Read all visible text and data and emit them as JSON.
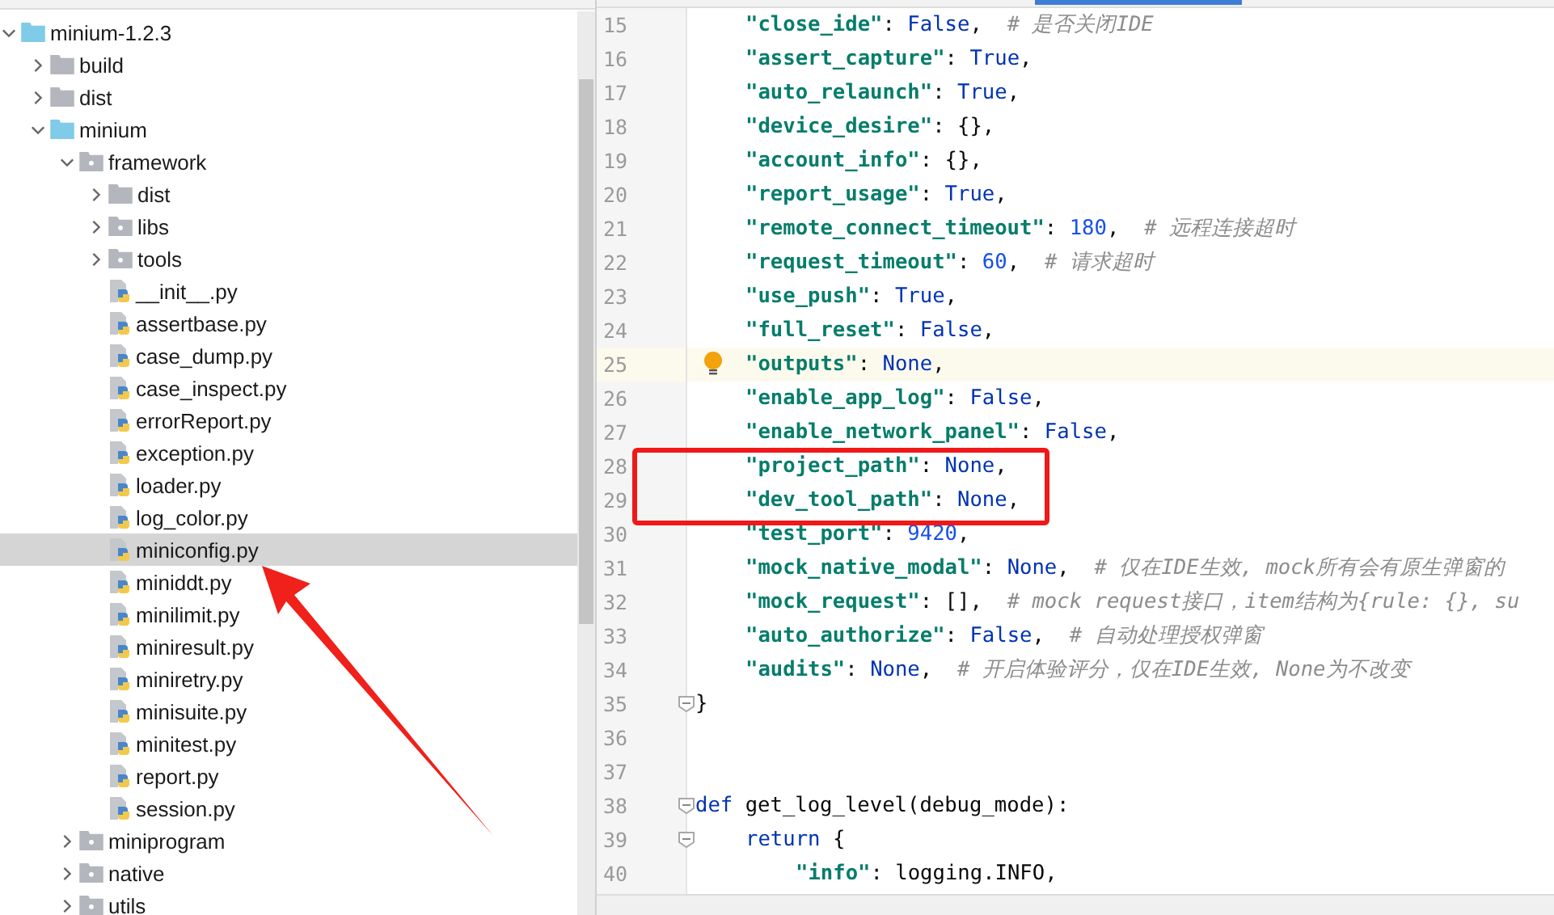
{
  "project_tree": [
    {
      "name": "minium-1.2.3",
      "kind": "root",
      "expanded": true,
      "selected": false,
      "children": [
        {
          "name": "build",
          "kind": "folder",
          "expanded": false,
          "selected": false
        },
        {
          "name": "dist",
          "kind": "folder",
          "expanded": false,
          "selected": false
        },
        {
          "name": "minium",
          "kind": "root",
          "expanded": true,
          "selected": false,
          "children": [
            {
              "name": "framework",
              "kind": "package",
              "expanded": true,
              "selected": false,
              "children": [
                {
                  "name": "dist",
                  "kind": "folder",
                  "expanded": false,
                  "selected": false
                },
                {
                  "name": "libs",
                  "kind": "package",
                  "expanded": false,
                  "selected": false
                },
                {
                  "name": "tools",
                  "kind": "package",
                  "expanded": false,
                  "selected": false
                },
                {
                  "name": "__init__.py",
                  "kind": "python",
                  "selected": false
                },
                {
                  "name": "assertbase.py",
                  "kind": "python",
                  "selected": false
                },
                {
                  "name": "case_dump.py",
                  "kind": "python",
                  "selected": false
                },
                {
                  "name": "case_inspect.py",
                  "kind": "python",
                  "selected": false
                },
                {
                  "name": "errorReport.py",
                  "kind": "python",
                  "selected": false
                },
                {
                  "name": "exception.py",
                  "kind": "python",
                  "selected": false
                },
                {
                  "name": "loader.py",
                  "kind": "python",
                  "selected": false
                },
                {
                  "name": "log_color.py",
                  "kind": "python",
                  "selected": false
                },
                {
                  "name": "miniconfig.py",
                  "kind": "python",
                  "selected": true
                },
                {
                  "name": "miniddt.py",
                  "kind": "python",
                  "selected": false
                },
                {
                  "name": "minilimit.py",
                  "kind": "python",
                  "selected": false
                },
                {
                  "name": "miniresult.py",
                  "kind": "python",
                  "selected": false
                },
                {
                  "name": "miniretry.py",
                  "kind": "python",
                  "selected": false
                },
                {
                  "name": "minisuite.py",
                  "kind": "python",
                  "selected": false
                },
                {
                  "name": "minitest.py",
                  "kind": "python",
                  "selected": false
                },
                {
                  "name": "report.py",
                  "kind": "python",
                  "selected": false
                },
                {
                  "name": "session.py",
                  "kind": "python",
                  "selected": false
                }
              ]
            },
            {
              "name": "miniprogram",
              "kind": "package",
              "expanded": false,
              "selected": false
            },
            {
              "name": "native",
              "kind": "package",
              "expanded": false,
              "selected": false
            },
            {
              "name": "utils",
              "kind": "package",
              "expanded": false,
              "selected": false
            }
          ]
        }
      ]
    }
  ],
  "editor": {
    "lines": [
      {
        "number": "15",
        "kind": "block",
        "tokens": [
          {
            "kind": "string",
            "text": "\"close_ide\""
          },
          {
            "kind": "plain",
            "text": ": "
          },
          {
            "kind": "keyword",
            "text": "False"
          },
          {
            "kind": "plain",
            "text": ",  "
          },
          {
            "kind": "comment",
            "text": "# 是否关闭IDE"
          }
        ]
      },
      {
        "number": "16",
        "kind": "block",
        "tokens": [
          {
            "kind": "string",
            "text": "\"assert_capture\""
          },
          {
            "kind": "plain",
            "text": ": "
          },
          {
            "kind": "keyword",
            "text": "True"
          },
          {
            "kind": "plain",
            "text": ","
          }
        ]
      },
      {
        "number": "17",
        "kind": "block",
        "tokens": [
          {
            "kind": "string",
            "text": "\"auto_relaunch\""
          },
          {
            "kind": "plain",
            "text": ": "
          },
          {
            "kind": "keyword",
            "text": "True"
          },
          {
            "kind": "plain",
            "text": ","
          }
        ]
      },
      {
        "number": "18",
        "kind": "block",
        "tokens": [
          {
            "kind": "string",
            "text": "\"device_desire\""
          },
          {
            "kind": "plain",
            "text": ": {},"
          }
        ]
      },
      {
        "number": "19",
        "kind": "block",
        "tokens": [
          {
            "kind": "string",
            "text": "\"account_info\""
          },
          {
            "kind": "plain",
            "text": ": {},"
          }
        ]
      },
      {
        "number": "20",
        "kind": "block",
        "tokens": [
          {
            "kind": "string",
            "text": "\"report_usage\""
          },
          {
            "kind": "plain",
            "text": ": "
          },
          {
            "kind": "keyword",
            "text": "True"
          },
          {
            "kind": "plain",
            "text": ","
          }
        ]
      },
      {
        "number": "21",
        "kind": "block",
        "tokens": [
          {
            "kind": "string",
            "text": "\"remote_connect_timeout\""
          },
          {
            "kind": "plain",
            "text": ": "
          },
          {
            "kind": "number",
            "text": "180"
          },
          {
            "kind": "plain",
            "text": ",  "
          },
          {
            "kind": "comment",
            "text": "# 远程连接超时"
          }
        ]
      },
      {
        "number": "22",
        "kind": "block",
        "tokens": [
          {
            "kind": "string",
            "text": "\"request_timeout\""
          },
          {
            "kind": "plain",
            "text": ": "
          },
          {
            "kind": "number",
            "text": "60"
          },
          {
            "kind": "plain",
            "text": ",  "
          },
          {
            "kind": "comment",
            "text": "# 请求超时"
          }
        ]
      },
      {
        "number": "23",
        "kind": "block",
        "tokens": [
          {
            "kind": "string",
            "text": "\"use_push\""
          },
          {
            "kind": "plain",
            "text": ": "
          },
          {
            "kind": "keyword",
            "text": "True"
          },
          {
            "kind": "plain",
            "text": ","
          }
        ]
      },
      {
        "number": "24",
        "kind": "block",
        "tokens": [
          {
            "kind": "string",
            "text": "\"full_reset\""
          },
          {
            "kind": "plain",
            "text": ": "
          },
          {
            "kind": "keyword",
            "text": "False"
          },
          {
            "kind": "plain",
            "text": ","
          }
        ]
      },
      {
        "number": "25",
        "kind": "block",
        "current": true,
        "bulb": true,
        "tokens": [
          {
            "kind": "string",
            "text": "\"outputs\""
          },
          {
            "kind": "plain",
            "text": ": "
          },
          {
            "kind": "keyword",
            "text": "None"
          },
          {
            "kind": "plain",
            "text": ","
          }
        ]
      },
      {
        "number": "26",
        "kind": "block",
        "tokens": [
          {
            "kind": "string",
            "text": "\"enable_app_log\""
          },
          {
            "kind": "plain",
            "text": ": "
          },
          {
            "kind": "keyword",
            "text": "False"
          },
          {
            "kind": "plain",
            "text": ","
          }
        ]
      },
      {
        "number": "27",
        "kind": "block",
        "tokens": [
          {
            "kind": "string",
            "text": "\"enable_network_panel\""
          },
          {
            "kind": "plain",
            "text": ": "
          },
          {
            "kind": "keyword",
            "text": "False"
          },
          {
            "kind": "plain",
            "text": ","
          }
        ]
      },
      {
        "number": "28",
        "kind": "block",
        "boxed": true,
        "tokens": [
          {
            "kind": "string",
            "text": "\"project_path\""
          },
          {
            "kind": "plain",
            "text": ": "
          },
          {
            "kind": "keyword",
            "text": "None"
          },
          {
            "kind": "plain",
            "text": ","
          }
        ]
      },
      {
        "number": "29",
        "kind": "block",
        "boxed": true,
        "tokens": [
          {
            "kind": "string",
            "text": "\"dev_tool_path\""
          },
          {
            "kind": "plain",
            "text": ": "
          },
          {
            "kind": "keyword",
            "text": "None"
          },
          {
            "kind": "plain",
            "text": ","
          }
        ]
      },
      {
        "number": "30",
        "kind": "block",
        "tokens": [
          {
            "kind": "string",
            "text": "\"test_port\""
          },
          {
            "kind": "plain",
            "text": ": "
          },
          {
            "kind": "number",
            "text": "9420"
          },
          {
            "kind": "plain",
            "text": ","
          }
        ]
      },
      {
        "number": "31",
        "kind": "block",
        "tokens": [
          {
            "kind": "string",
            "text": "\"mock_native_modal\""
          },
          {
            "kind": "plain",
            "text": ": "
          },
          {
            "kind": "keyword",
            "text": "None"
          },
          {
            "kind": "plain",
            "text": ",  "
          },
          {
            "kind": "comment",
            "text": "# 仅在IDE生效, mock所有会有原生弹窗的"
          }
        ]
      },
      {
        "number": "32",
        "kind": "block",
        "tokens": [
          {
            "kind": "string",
            "text": "\"mock_request\""
          },
          {
            "kind": "plain",
            "text": ": [],  "
          },
          {
            "kind": "comment",
            "text": "# mock request接口，item结构为{rule: {}, su"
          }
        ]
      },
      {
        "number": "33",
        "kind": "block",
        "tokens": [
          {
            "kind": "string",
            "text": "\"auto_authorize\""
          },
          {
            "kind": "plain",
            "text": ": "
          },
          {
            "kind": "keyword",
            "text": "False"
          },
          {
            "kind": "plain",
            "text": ",  "
          },
          {
            "kind": "comment",
            "text": "# 自动处理授权弹窗"
          }
        ]
      },
      {
        "number": "34",
        "kind": "block",
        "tokens": [
          {
            "kind": "string",
            "text": "\"audits\""
          },
          {
            "kind": "plain",
            "text": ": "
          },
          {
            "kind": "keyword",
            "text": "None"
          },
          {
            "kind": "plain",
            "text": ",  "
          },
          {
            "kind": "comment",
            "text": "# 开启体验评分，仅在IDE生效, None为不改变"
          }
        ]
      },
      {
        "number": "35",
        "kind": "top",
        "fold": true,
        "tokens": [
          {
            "kind": "plain",
            "text": "}"
          }
        ]
      },
      {
        "number": "36",
        "kind": "top"
      },
      {
        "number": "37",
        "kind": "top"
      },
      {
        "number": "38",
        "kind": "top",
        "fold": true,
        "tokens": [
          {
            "kind": "keyword",
            "text": "def"
          },
          {
            "kind": "plain",
            "text": " get_log_level(debug_mode):"
          }
        ]
      },
      {
        "number": "39",
        "kind": "block",
        "fold": true,
        "tokens": [
          {
            "kind": "keyword",
            "text": "return"
          },
          {
            "kind": "plain",
            "text": " {"
          }
        ]
      },
      {
        "number": "40",
        "kind": "nested",
        "tokens": [
          {
            "kind": "string",
            "text": "\"info\""
          },
          {
            "kind": "plain",
            "text": ": logging.INFO,"
          }
        ]
      }
    ]
  }
}
